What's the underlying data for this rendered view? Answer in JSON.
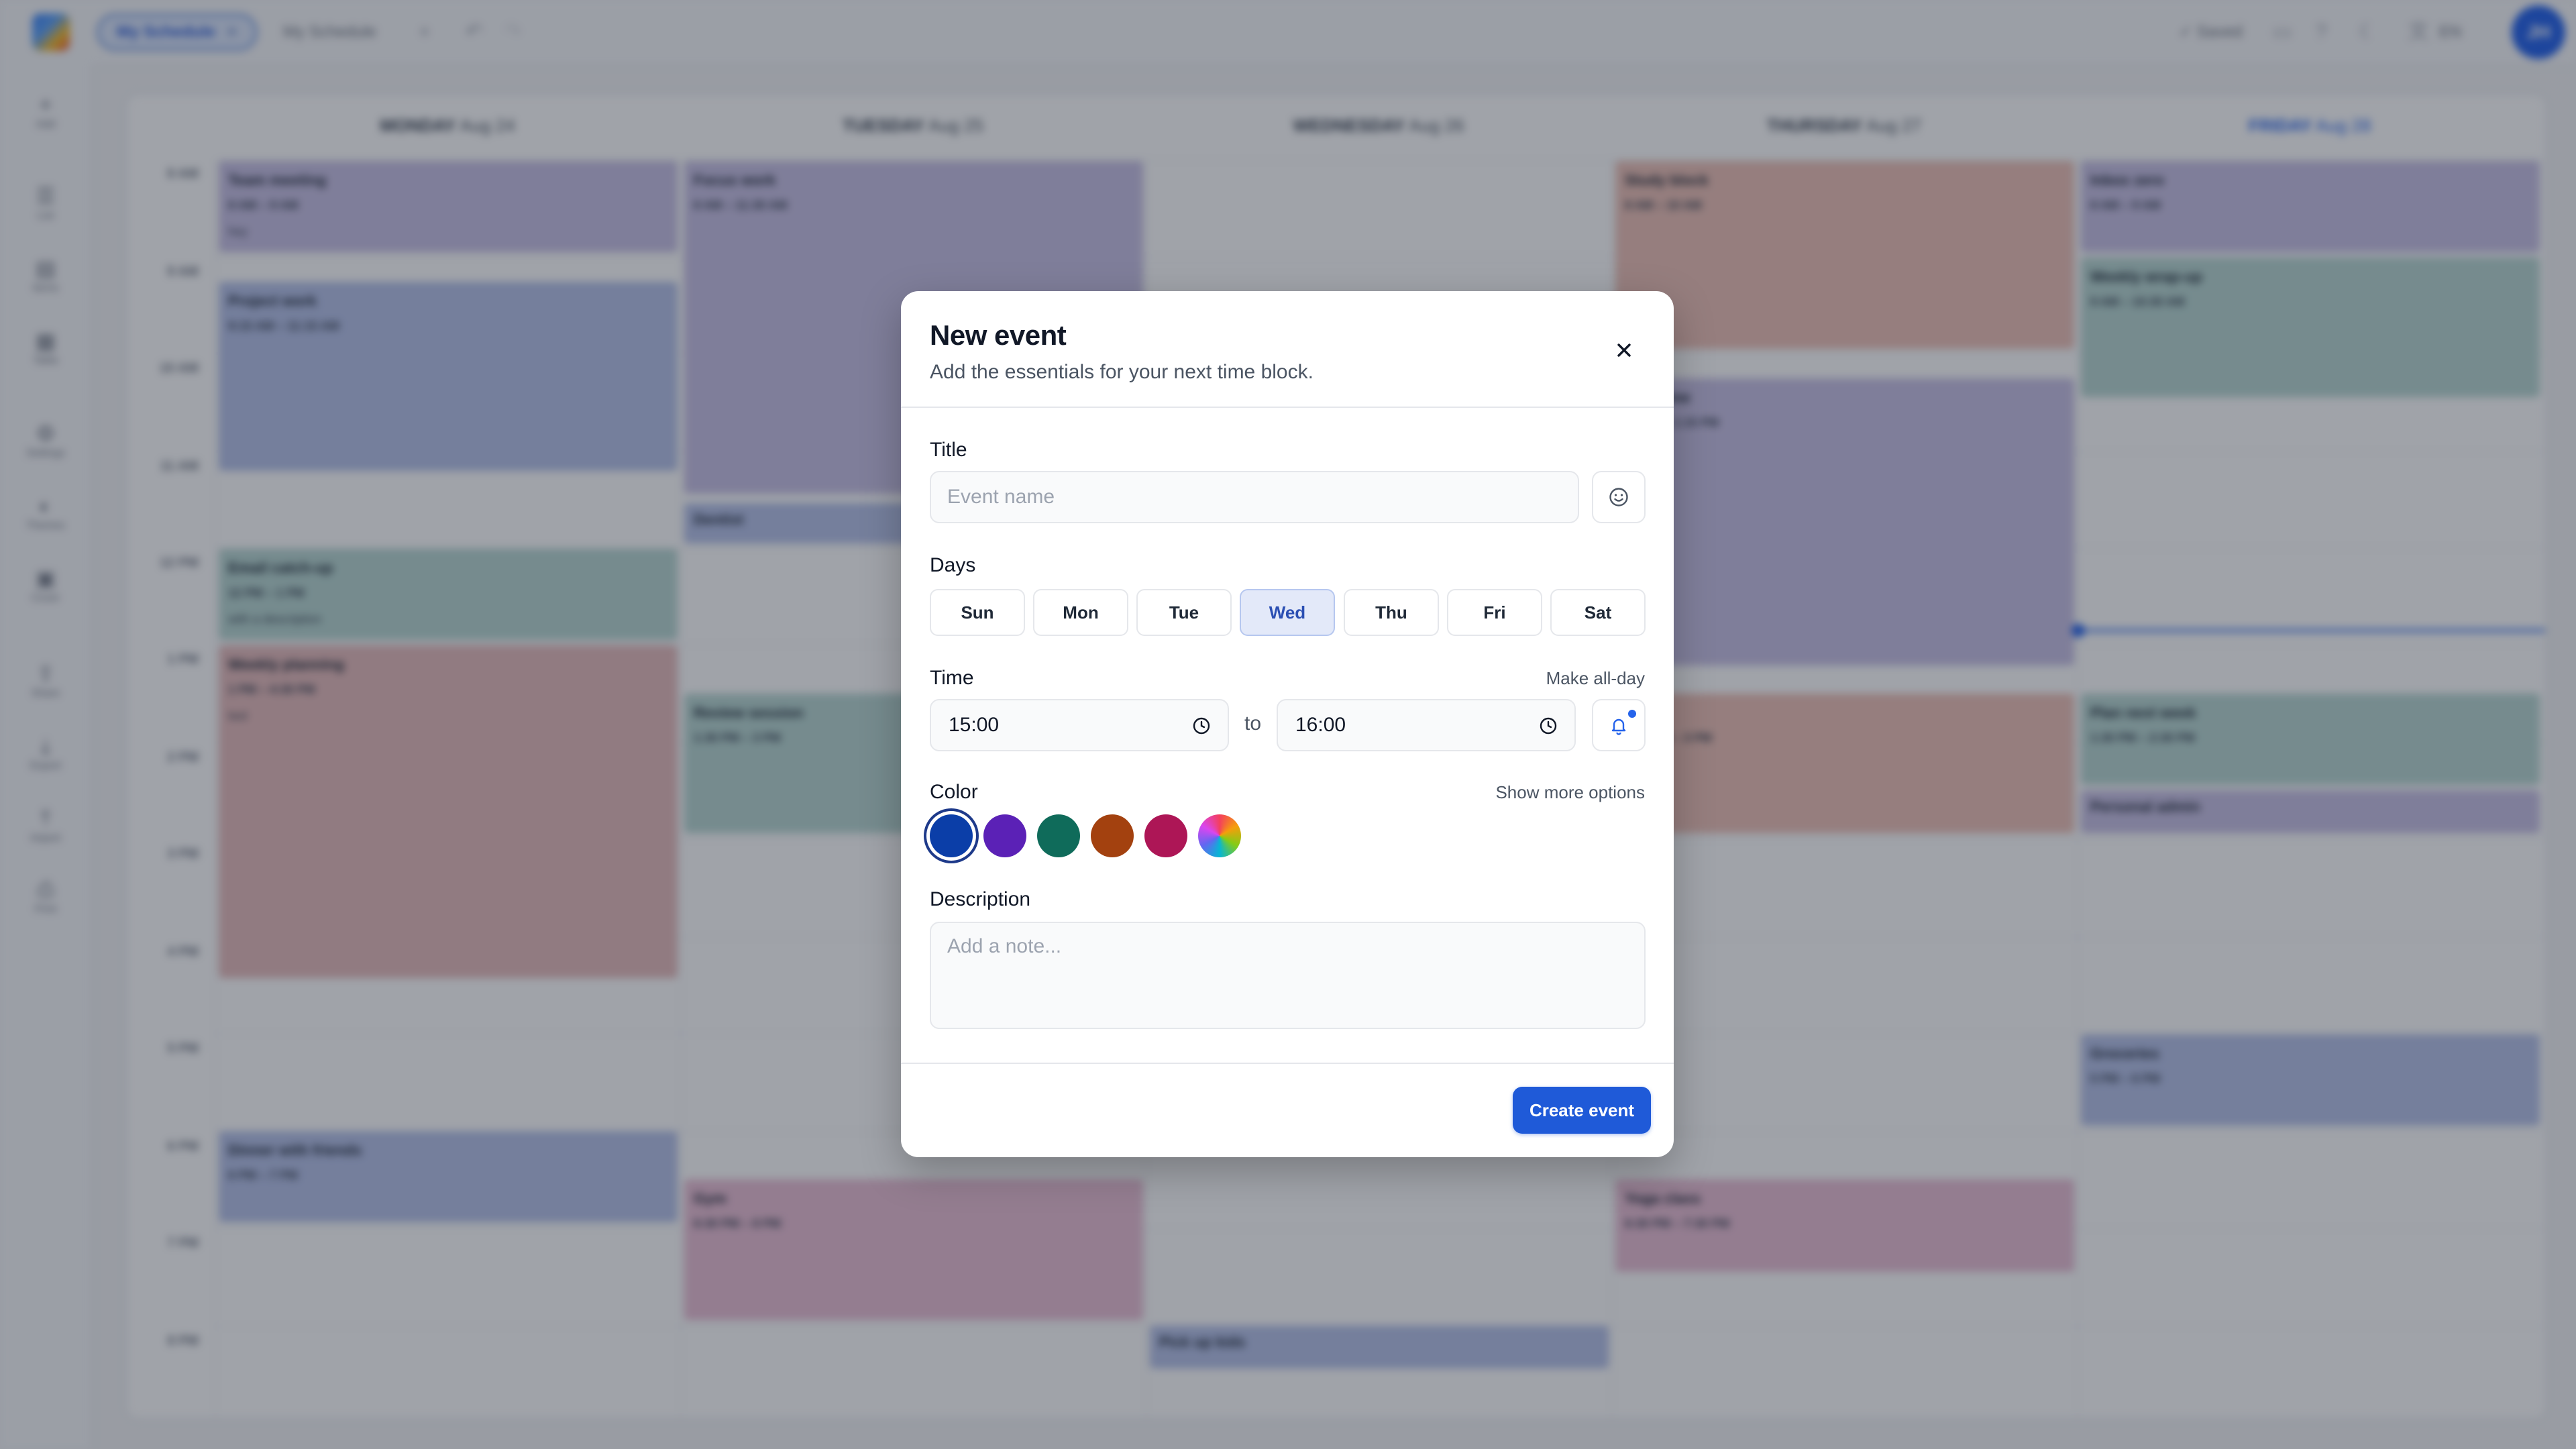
{
  "topbar": {
    "active_tab": "My Schedule",
    "second_tab": "My Schedule",
    "save_status": "✓ Saved",
    "language": "EN",
    "user_initials": "JH"
  },
  "sidebar": {
    "items": [
      {
        "label": "Add",
        "icon": "+"
      },
      {
        "label": "List",
        "icon": "☰"
      },
      {
        "label": "Items",
        "icon": "▤"
      },
      {
        "label": "Table",
        "icon": "▦"
      },
      {
        "label": "Settings",
        "icon": "⚙"
      },
      {
        "label": "Themes",
        "icon": "◐"
      },
      {
        "label": "Cover",
        "icon": "▣"
      },
      {
        "label": "Share",
        "icon": "⇪"
      },
      {
        "label": "Export",
        "icon": "⤓"
      },
      {
        "label": "Import",
        "icon": "⤒"
      },
      {
        "label": "Print",
        "icon": "⎙"
      }
    ]
  },
  "calendar": {
    "days": [
      {
        "name": "MONDAY",
        "date": "Aug 24"
      },
      {
        "name": "TUESDAY",
        "date": "Aug 25"
      },
      {
        "name": "WEDNESDAY",
        "date": "Aug 26"
      },
      {
        "name": "THURSDAY",
        "date": "Aug 27"
      },
      {
        "name": "FRIDAY",
        "date": "Aug 28"
      }
    ],
    "times": [
      "8 AM",
      "9 AM",
      "10 AM",
      "11 AM",
      "12 PM",
      "1 PM",
      "2 PM",
      "3 PM",
      "4 PM",
      "5 PM",
      "6 PM",
      "7 PM",
      "8 PM"
    ],
    "events": {
      "mon_team": {
        "title": "Team meeting",
        "time": "8 AM – 9 AM",
        "note": "hey"
      },
      "mon_project": {
        "title": "Project work",
        "time": "9:15 AM – 11:15 AM"
      },
      "mon_email": {
        "title": "Email catch-up",
        "time": "12 PM – 1 PM",
        "note": "with a description"
      },
      "mon_weekly": {
        "title": "Weekly planning",
        "time": "1 PM – 4:30 PM",
        "note": "test"
      },
      "mon_dinner": {
        "title": "Dinner with friends",
        "time": "6 PM – 7 PM"
      },
      "tue_focus": {
        "title": "Focus work",
        "time": "8 AM – 11:30 AM"
      },
      "tue_dentist": {
        "title": "Dentist"
      },
      "tue_review": {
        "title": "Review session",
        "time": "1:30 PM – 3 PM"
      },
      "tue_gym": {
        "title": "Gym",
        "time": "6:30 PM – 8 PM"
      },
      "wed_pickup": {
        "title": "Pick up kids"
      },
      "thu_study": {
        "title": "Study block",
        "time": "8 AM – 10 AM"
      },
      "thu_free": {
        "title": "Free time",
        "time": "10 AM – 1:15 PM"
      },
      "thu_work": {
        "title": "Work",
        "time": "1:30 PM – 3 PM"
      },
      "thu_yoga": {
        "title": "Yoga class",
        "time": "6:30 PM – 7:30 PM"
      },
      "fri_inbox": {
        "title": "Inbox zero",
        "time": "8 AM – 9 AM"
      },
      "fri_wrap": {
        "title": "Weekly wrap-up",
        "time": "9 AM – 10:30 AM"
      },
      "fri_plan": {
        "title": "Plan next week",
        "time": "1:30 PM – 2:30 PM"
      },
      "fri_admin": {
        "title": "Personal admin"
      },
      "fri_groceries": {
        "title": "Groceries",
        "time": "5 PM – 6 PM"
      }
    }
  },
  "modal": {
    "title": "New event",
    "subtitle": "Add the essentials for your next time block.",
    "title_label": "Title",
    "title_placeholder": "Event name",
    "title_value": "",
    "days_label": "Days",
    "days": [
      "Sun",
      "Mon",
      "Tue",
      "Wed",
      "Thu",
      "Fri",
      "Sat"
    ],
    "selected_day": "Wed",
    "time_label": "Time",
    "all_day_link": "Make all-day",
    "start_time": "15:00",
    "to_label": "to",
    "end_time": "16:00",
    "color_label": "Color",
    "more_options_link": "Show more options",
    "colors": [
      "#0b3ea8",
      "#5b21b6",
      "#0f6b5a",
      "#a3410f",
      "#ad1656",
      "rainbow"
    ],
    "selected_color": "#0b3ea8",
    "description_label": "Description",
    "description_placeholder": "Add a note...",
    "description_value": "",
    "create_button": "Create event"
  }
}
